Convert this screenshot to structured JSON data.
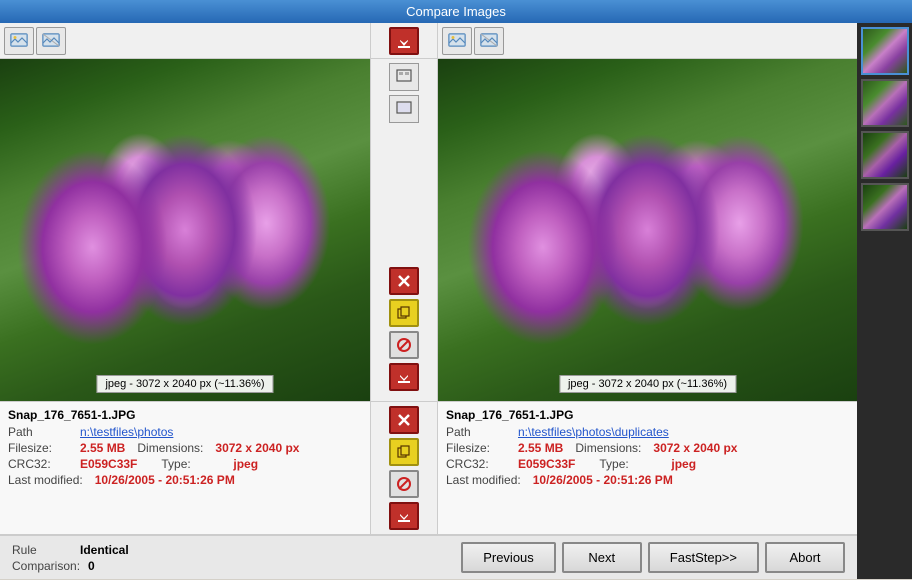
{
  "titleBar": {
    "label": "Compare Images"
  },
  "leftImage": {
    "label": "jpeg - 3072 x 2040 px (~11.36%)",
    "fileName": "Snap_176_7651-1.JPG",
    "path": "n:\\testfiles\\photos",
    "filesize": "2.55 MB",
    "dimensions": "3072 x 2040 px",
    "crc32": "E059C33F",
    "type": "jpeg",
    "lastModified": "10/26/2005 - 20:51:26 PM"
  },
  "rightImage": {
    "label": "jpeg - 3072 x 2040 px (~11.36%)",
    "fileName": "Snap_176_7651-1.JPG",
    "path": "n:\\testfiles\\photos\\duplicates",
    "filesize": "2.55 MB",
    "dimensions": "3072 x 2040 px",
    "crc32": "E059C33F",
    "type": "jpeg",
    "lastModified": "10/26/2005 - 20:51:26 PM"
  },
  "info": {
    "pathLabel": "Path",
    "filesizeLabel": "Filesize:",
    "dimensionsLabel": "Dimensions:",
    "crc32Label": "CRC32:",
    "typeLabel": "Type:",
    "lastModifiedLabel": "Last modified:"
  },
  "rule": {
    "label": "Rule",
    "value": "Identical",
    "comparisonLabel": "Comparison:",
    "comparisonValue": "0"
  },
  "buttons": {
    "previous": "Previous",
    "next": "Next",
    "fastStep": "FastStep>>",
    "abort": "Abort"
  },
  "thumbnails": [
    {
      "id": "thumb-1",
      "active": true
    },
    {
      "id": "thumb-2",
      "active": false
    },
    {
      "id": "thumb-3",
      "active": false
    },
    {
      "id": "thumb-4",
      "active": false
    }
  ],
  "middleActions": {
    "deleteLeft": "✕",
    "copyLeft": "📋",
    "noAction": "🚫",
    "deleteRight": "✕",
    "copyRight": "📋",
    "downloadRight": "⬇"
  }
}
